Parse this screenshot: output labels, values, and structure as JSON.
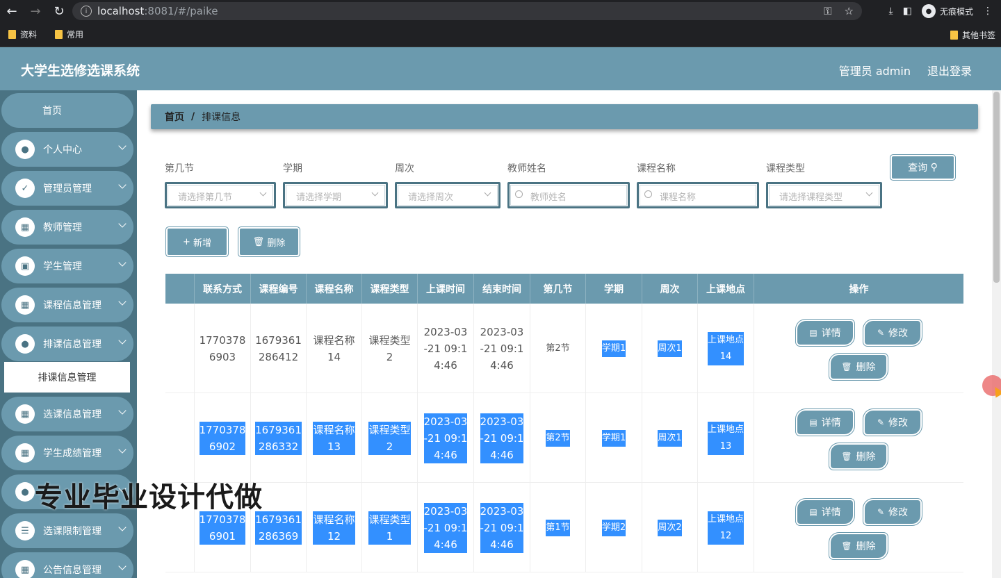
{
  "browser": {
    "url_host": "localhost",
    "url_rest": ":8081/#/paike",
    "incognito_label": "无痕模式",
    "bookmarks": [
      "资料",
      "常用"
    ],
    "other_bookmarks": "其他书签"
  },
  "header": {
    "title": "大学生选修选课系统",
    "user": "管理员 admin",
    "logout": "退出登录"
  },
  "sidebar": {
    "items": [
      {
        "label": "首页",
        "icon": "home-icon"
      },
      {
        "label": "个人中心",
        "icon": "user-icon"
      },
      {
        "label": "管理员管理",
        "icon": "clipboard-icon"
      },
      {
        "label": "教师管理",
        "icon": "grid-icon"
      },
      {
        "label": "学生管理",
        "icon": "briefcase-icon"
      },
      {
        "label": "课程信息管理",
        "icon": "grid-icon"
      },
      {
        "label": "排课信息管理",
        "icon": "user-icon"
      },
      {
        "label": "选课信息管理",
        "icon": "grid-icon"
      },
      {
        "label": "学生成绩管理",
        "icon": "grid-icon"
      },
      {
        "label": "",
        "icon": "bulb-icon"
      },
      {
        "label": "选课限制管理",
        "icon": "list-icon"
      },
      {
        "label": "公告信息管理",
        "icon": "grid-icon"
      }
    ],
    "sub_item": "排课信息管理"
  },
  "breadcrumb": {
    "home": "首页",
    "sep": "/",
    "current": "排课信息"
  },
  "filters": [
    {
      "label": "第几节",
      "placeholder": "请选择第几节",
      "type": "select"
    },
    {
      "label": "学期",
      "placeholder": "请选择学期",
      "type": "select"
    },
    {
      "label": "周次",
      "placeholder": "请选择周次",
      "type": "select"
    },
    {
      "label": "教师姓名",
      "placeholder": "教师姓名",
      "type": "text"
    },
    {
      "label": "课程名称",
      "placeholder": "课程名称",
      "type": "text"
    },
    {
      "label": "课程类型",
      "placeholder": "请选择课程类型",
      "type": "select"
    }
  ],
  "buttons": {
    "query": "查询",
    "add": "新增",
    "delete": "删除"
  },
  "table": {
    "columns": [
      "联系方式",
      "课程编号",
      "课程名称",
      "课程类型",
      "上课时间",
      "结束时间",
      "第几节",
      "学期",
      "周次",
      "上课地点",
      "操作"
    ],
    "rows": [
      {
        "phone": "1770378\n6903",
        "code": "1679361\n286412",
        "name": "课程名称\n14",
        "type": "课程类型\n2",
        "start": "2023-03\n-21 09:1\n4:46",
        "end": "2023-03\n-21 09:1\n4:46",
        "section": "第2节",
        "term": "学期1",
        "week": "周次1",
        "place": "上课地点\n14"
      },
      {
        "phone": "1770378\n6902",
        "code": "1679361\n286332",
        "name": "课程名称\n13",
        "type": "课程类型\n2",
        "start": "2023-03\n-21 09:1\n4:46",
        "end": "2023-03\n-21 09:1\n4:46",
        "section": "第2节",
        "term": "学期1",
        "week": "周次1",
        "place": "上课地点\n13"
      },
      {
        "phone": "1770378\n6901",
        "code": "1679361\n286369",
        "name": "课程名称\n12",
        "type": "课程类型\n1",
        "start": "2023-03\n-21 09:1\n4:46",
        "end": "2023-03\n-21 09:1\n4:46",
        "section": "第1节",
        "term": "学期2",
        "week": "周次2",
        "place": "上课地点\n12"
      }
    ],
    "actions": {
      "detail": "详情",
      "edit": "修改",
      "delete": "删除"
    }
  },
  "watermark": "专业毕业设计代做",
  "colors": {
    "primary": "#6b9aae",
    "sidebar": "#4a7383",
    "selection": "#3390ff"
  }
}
